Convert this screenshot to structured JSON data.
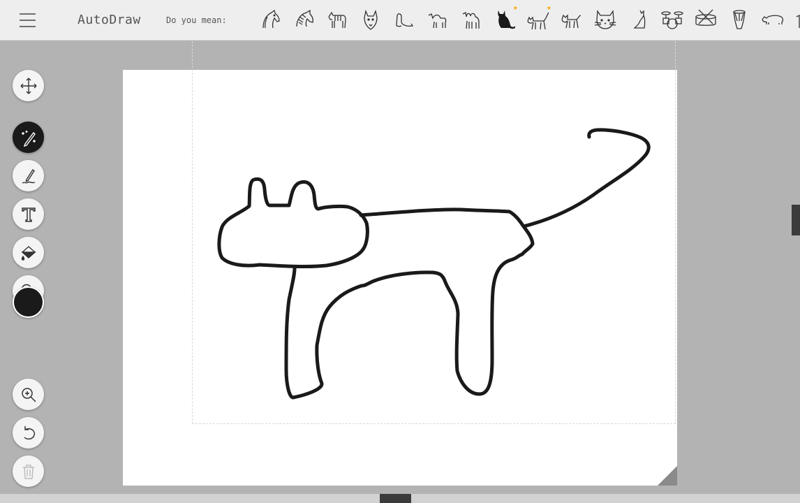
{
  "app": {
    "title": "AutoDraw"
  },
  "header": {
    "menu_icon": "hamburger-menu-icon",
    "suggestions_label": "Do you mean:",
    "suggestions": [
      {
        "name": "horse-head-icon"
      },
      {
        "name": "zebra-head-icon"
      },
      {
        "name": "zebra-icon"
      },
      {
        "name": "wolf-face-icon"
      },
      {
        "name": "seal-icon"
      },
      {
        "name": "camel-icon"
      },
      {
        "name": "camel-two-hump-icon"
      },
      {
        "name": "black-cat-icon",
        "starred": true
      },
      {
        "name": "cat-walking-icon",
        "starred": true
      },
      {
        "name": "cat-outline-icon"
      },
      {
        "name": "cat-face-icon"
      },
      {
        "name": "cat-sitting-icon"
      },
      {
        "name": "drum-kit-icon"
      },
      {
        "name": "snare-drum-icon"
      },
      {
        "name": "djembe-drum-icon"
      },
      {
        "name": "rhino-icon"
      },
      {
        "name": "partial-icon"
      }
    ]
  },
  "toolbar": {
    "tools": [
      {
        "name": "move-tool-icon",
        "active": false
      },
      {
        "name": "autodraw-tool-icon",
        "active": true
      },
      {
        "name": "draw-tool-icon",
        "active": false
      },
      {
        "name": "type-tool-icon",
        "active": false
      },
      {
        "name": "fill-tool-icon",
        "active": false
      },
      {
        "name": "shape-tool-icon",
        "active": false
      }
    ],
    "color": "#1a1a1a",
    "actions": [
      {
        "name": "zoom-in-icon"
      },
      {
        "name": "undo-icon"
      },
      {
        "name": "delete-icon"
      }
    ]
  },
  "colors": {
    "accent_star": "#f5a800",
    "stroke": "#1a1a1a",
    "background": "#b3b3b3"
  }
}
